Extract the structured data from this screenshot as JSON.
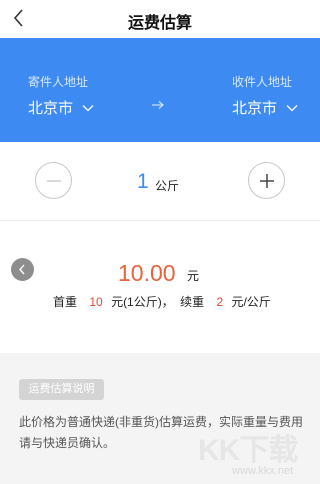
{
  "nav": {
    "title": "运费估算",
    "back_icon": "chevron-left-icon"
  },
  "route": {
    "from_label": "寄件人地址",
    "from_city": "北京市",
    "to_label": "收件人地址",
    "to_city": "北京市",
    "arrow_icon": "arrow-right-icon",
    "background": "#3d8bf2"
  },
  "weight": {
    "value": "1",
    "unit": "公斤"
  },
  "price": {
    "amount": "10.00",
    "amount_unit": "元",
    "first_weight_label": "首重",
    "first_weight_value": "10",
    "first_weight_unit": "元(1公斤)，",
    "continued_weight_label": "续重",
    "continued_weight_value": "2",
    "continued_weight_unit": "元/公斤",
    "accent": "#e8643a"
  },
  "notes": {
    "tag": "运费估算说明",
    "text": "此价格为普通快递(非重货)估算运费，实际重量与费用请与快递员确认。"
  },
  "watermark": {
    "brand": "KK下载",
    "url": "www.kkx.net"
  }
}
